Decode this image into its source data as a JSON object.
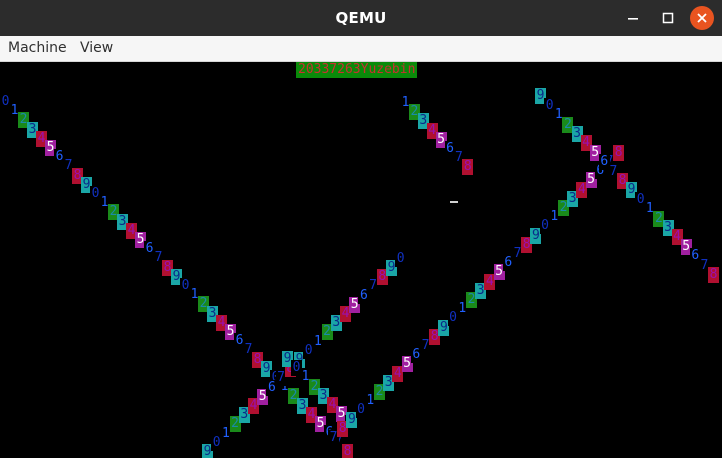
{
  "window": {
    "title": "QEMU",
    "controls": {
      "minimize_icon": "minimize-icon",
      "maximize_icon": "maximize-icon",
      "close_icon": "close-icon"
    }
  },
  "menu": {
    "items": [
      {
        "label": "Machine"
      },
      {
        "label": "View"
      }
    ]
  },
  "screen": {
    "banner": "20337263Yuzebin",
    "palette": {
      "blue": {
        "bg": "#000000",
        "fg": "#2060ff"
      },
      "cyan": {
        "bg": "#1aa6a6",
        "fg": "#0a2a8a"
      },
      "green": {
        "bg": "#1a8a1a",
        "fg": "#1a8aaa"
      },
      "red": {
        "bg": "#b01030",
        "fg": "#9a10b0"
      },
      "magenta": {
        "bg": "#a020a0",
        "fg": "#ffffff"
      },
      "darkblue": {
        "bg": "#000000",
        "fg": "#1030c0"
      },
      "blue_on_blue": {
        "bg": "#1040d0",
        "fg": "#ffffff"
      }
    },
    "chars": [
      "0",
      "1",
      "2",
      "3",
      "4",
      "5",
      "6",
      "7",
      "8",
      "9",
      "0",
      "1",
      "2",
      "3",
      "4",
      "5",
      "6",
      "7",
      "8",
      "9",
      "0",
      "1",
      "2",
      "3",
      "4",
      "5",
      "6",
      "7",
      "8",
      "9",
      "0",
      "1",
      "2",
      "3",
      "4",
      "5",
      "6",
      "7",
      "8",
      "9",
      "0",
      "1",
      "2",
      "3",
      "4",
      "5",
      "6",
      "7",
      "8",
      "9",
      "0",
      "1",
      "2",
      "3",
      "4",
      "5",
      "6",
      "7",
      "8",
      "9",
      "0",
      "1",
      "2",
      "3",
      "4",
      "5",
      "6",
      "7",
      "8",
      "9",
      "0",
      "1",
      "2",
      "3",
      "4",
      "5",
      "6",
      "7",
      "8",
      "9",
      "0",
      "1",
      "2",
      "3",
      "4",
      "5",
      "6",
      "7",
      "8",
      "9",
      "0",
      "1",
      "2",
      "3",
      "4",
      "5",
      "6",
      "7",
      "8",
      "9",
      "0",
      "1",
      "2",
      "3",
      "4",
      "5",
      "6",
      "7",
      "8",
      "9",
      "0",
      "1",
      "2",
      "3",
      "4",
      "5",
      "6",
      "7",
      "8",
      "9"
    ]
  }
}
